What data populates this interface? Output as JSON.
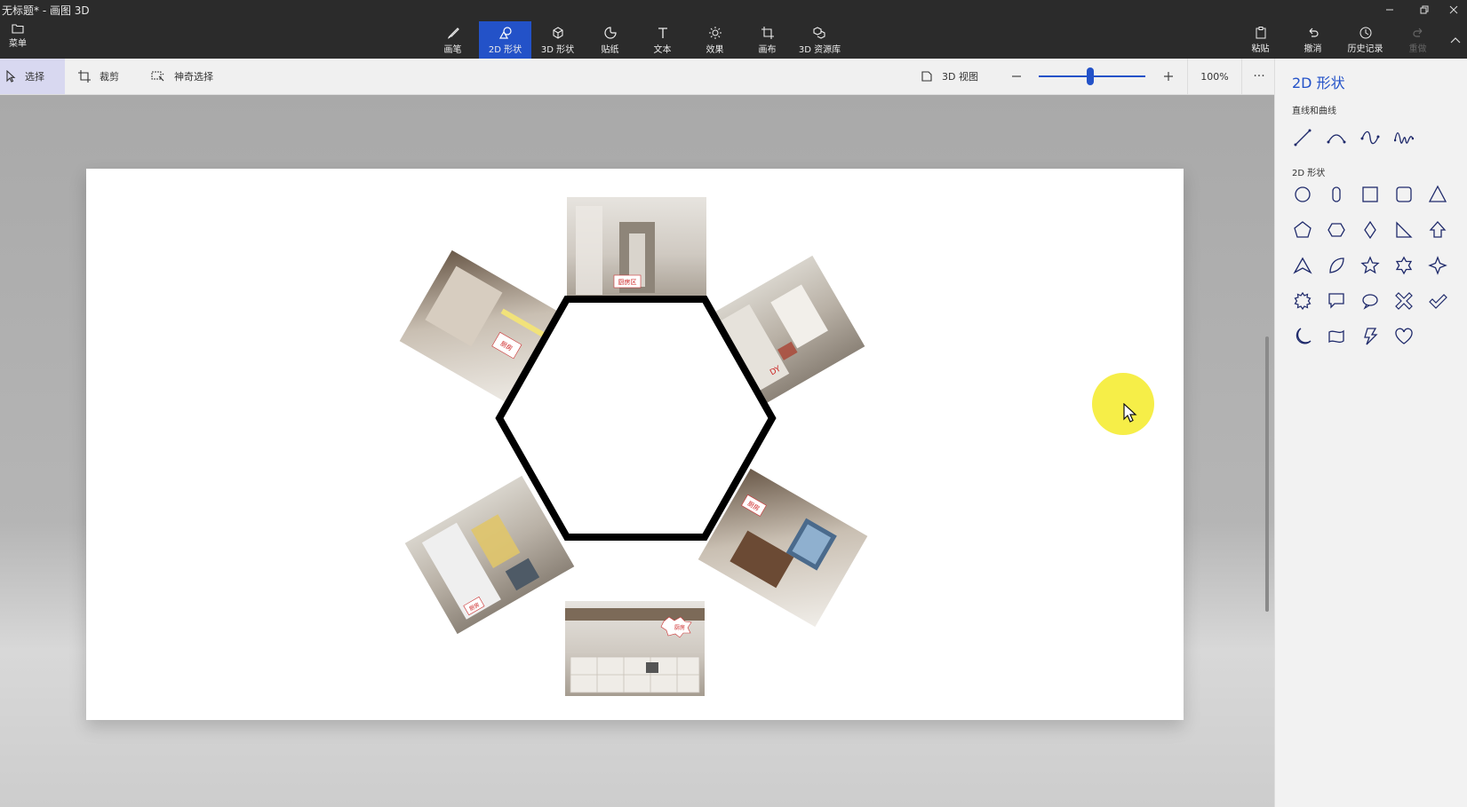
{
  "window": {
    "title": "无标题* - 画图 3D"
  },
  "ribbon": {
    "menu_label": "菜单",
    "tabs": [
      {
        "label": "画笔",
        "icon": "brush-icon"
      },
      {
        "label": "2D 形状",
        "icon": "shapes-2d-icon",
        "active": true
      },
      {
        "label": "3D 形状",
        "icon": "cube-icon"
      },
      {
        "label": "贴纸",
        "icon": "sticker-icon"
      },
      {
        "label": "文本",
        "icon": "text-icon"
      },
      {
        "label": "效果",
        "icon": "effects-icon"
      },
      {
        "label": "画布",
        "icon": "canvas-icon"
      },
      {
        "label": "3D 资源库",
        "icon": "library-icon"
      }
    ],
    "actions": [
      {
        "label": "粘贴",
        "icon": "paste-icon"
      },
      {
        "label": "撤消",
        "icon": "undo-icon"
      },
      {
        "label": "历史记录",
        "icon": "history-icon"
      },
      {
        "label": "重做",
        "icon": "redo-icon",
        "disabled": true
      }
    ]
  },
  "toolbar": {
    "select_label": "选择",
    "crop_label": "裁剪",
    "magic_select_label": "神奇选择",
    "view3d_label": "3D 视图",
    "zoom_value": "100%",
    "zoom_slider_fraction": 0.48
  },
  "panel": {
    "title": "2D 形状",
    "lines_section": "直线和曲线",
    "shapes_section": "2D 形状",
    "line_tools": [
      "line-icon",
      "curve-icon",
      "s-curve-icon",
      "wave-curve-icon"
    ],
    "shapes": [
      "circle-icon",
      "capsule-icon",
      "square-icon",
      "rounded-square-icon",
      "triangle-icon",
      "pentagon-icon",
      "hexagon-icon",
      "diamond-icon",
      "right-triangle-icon",
      "arrow-up-icon",
      "chevron-icon",
      "leaf-icon",
      "star-5-icon",
      "star-6-icon",
      "star-4-icon",
      "burst-icon",
      "speech-bubble-icon",
      "thought-bubble-icon",
      "x-icon",
      "check-icon",
      "moon-icon",
      "banner-icon",
      "lightning-icon",
      "heart-icon"
    ]
  },
  "canvas": {
    "photos": [
      {
        "id": "top",
        "label": "厨房区"
      },
      {
        "id": "top-right",
        "label": "DY"
      },
      {
        "id": "bottom-right",
        "label": "厨房"
      },
      {
        "id": "bottom",
        "label": "厨房"
      },
      {
        "id": "bottom-left",
        "label": "厨房"
      },
      {
        "id": "top-left",
        "label": "厨房"
      }
    ]
  },
  "colors": {
    "accent": "#2352c8",
    "ribbon": "#2b2b2b",
    "cursor_highlight": "#f5eb28"
  }
}
